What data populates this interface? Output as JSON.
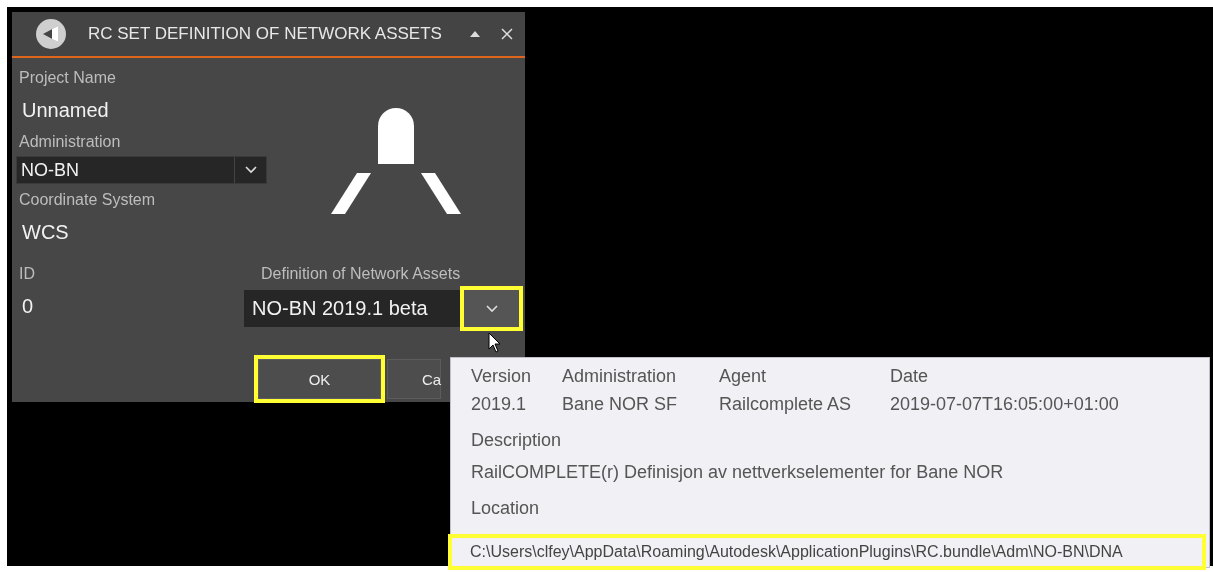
{
  "window": {
    "title": "RC SET DEFINITION OF NETWORK ASSETS"
  },
  "project_name": {
    "label": "Project Name",
    "value": "Unnamed"
  },
  "administration": {
    "label": "Administration",
    "value": "NO-BN"
  },
  "coordinate_system": {
    "label": "Coordinate System",
    "value": "WCS"
  },
  "id": {
    "label": "ID",
    "value": "0"
  },
  "definition": {
    "label": "Definition of Network Assets",
    "value": "NO-BN 2019.1 beta",
    "highlighted": true
  },
  "buttons": [
    {
      "label": "OK",
      "highlighted": true
    },
    {
      "label": "Ca",
      "highlighted": false
    }
  ],
  "popup": {
    "columns": [
      {
        "label": "Version",
        "value": "2019.1"
      },
      {
        "label": "Administration",
        "value": "Bane NOR SF"
      },
      {
        "label": "Agent",
        "value": "Railcomplete AS"
      },
      {
        "label": "Date",
        "value": "2019-07-07T16:05:00+01:00"
      }
    ],
    "description": {
      "label": "Description",
      "value": "RailCOMPLETE(r) Definisjon av nettverkselementer for Bane NOR"
    },
    "location": {
      "label": "Location",
      "value": "C:\\Users\\clfey\\AppData\\Roaming\\Autodesk\\ApplicationPlugins\\RC.bundle\\Adm\\NO-BN\\DNA",
      "highlighted": true
    }
  }
}
